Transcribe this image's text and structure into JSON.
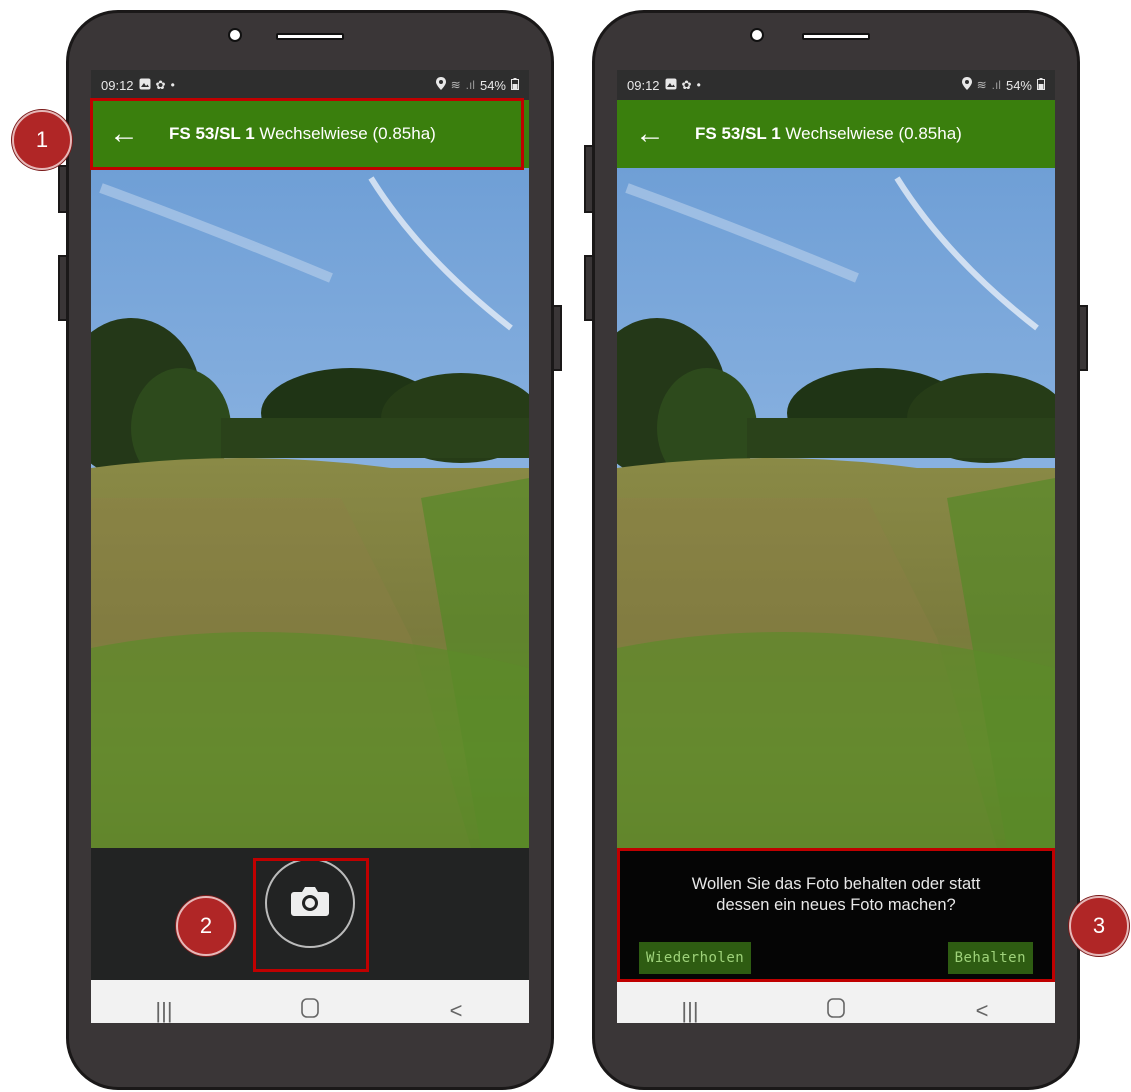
{
  "status_bar": {
    "time": "09:12",
    "battery": "54%",
    "icons": [
      "gallery-icon",
      "gear-icon",
      "dot-icon",
      "location-icon",
      "wifi-icon",
      "signal-icon",
      "battery-icon"
    ]
  },
  "app_bar": {
    "field_id": "FS 53/SL 1",
    "field_name": "Wechselwiese (0.85ha)",
    "back_icon": "arrow-left-icon",
    "color": "#3a7f0d"
  },
  "capture": {
    "shutter_icon": "camera-icon"
  },
  "confirm_dialog": {
    "message_line1": "Wollen Sie das Foto behalten oder statt",
    "message_line2": "dessen ein neues Foto machen?",
    "retake_label": "Wiederholen",
    "keep_label": "Behalten"
  },
  "nav_bar": {
    "recents": "|||",
    "home": "○",
    "back": "<"
  },
  "callouts": {
    "one": "1",
    "two": "2",
    "three": "3"
  },
  "highlight_color": "#c00000"
}
